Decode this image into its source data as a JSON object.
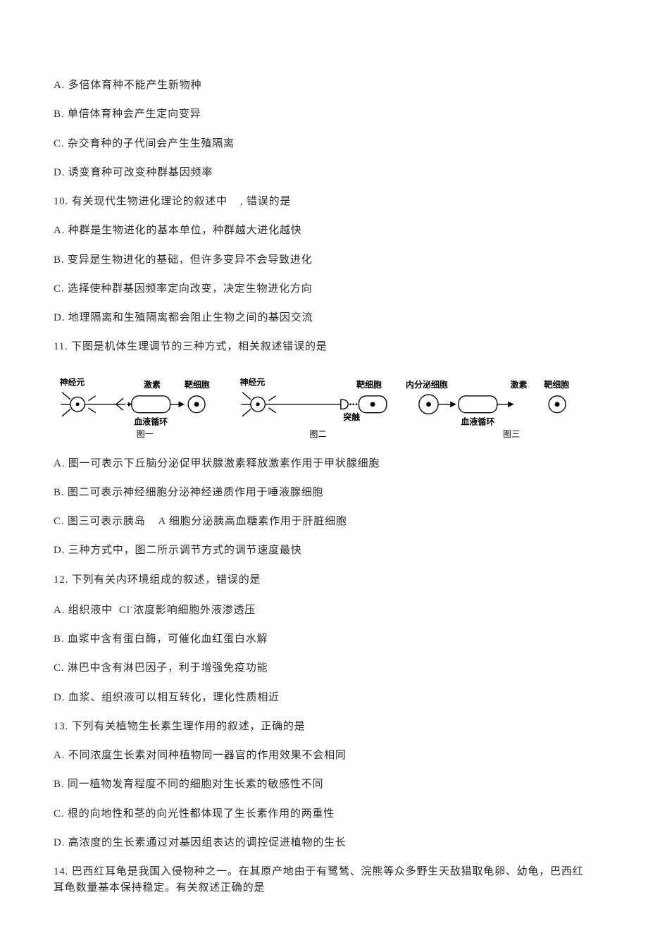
{
  "q9": {
    "A": "A. 多倍体育种不能产生新物种",
    "B": "B. 单倍体育种会产生定向变异",
    "C": "C. 杂交育种的子代间会产生生殖隔离",
    "D": "D. 诱变育种可改变种群基因频率"
  },
  "q10": {
    "stem_a": "10. 有关现代生物进化理论的叙述中",
    "stem_b": ", 错误的是",
    "A": "A. 种群是生物进化的基本单位，种群越大进化越快",
    "B": "B. 变异是生物进化的基础，但许多变异不会导致进化",
    "C": "C. 选择使种群基因频率定向改变，决定生物进化方向",
    "D": "D. 地理隔离和生殖隔离都会阻止生物之间的基因交流"
  },
  "q11": {
    "stem": "11. 下图是机体生理调节的三种方式，相关叙述错误的是",
    "fig_labels": {
      "neuron": "神经元",
      "hormone": "激素",
      "target": "靶细胞",
      "blood": "血液循环",
      "synapse": "突触",
      "endocrine": "内分泌细胞",
      "fig1": "图一",
      "fig2": "图二",
      "fig3": "图三"
    },
    "A": "A. 图一可表示下丘脑分泌促甲状腺激素释放激素作用于甲状腺细胞",
    "B": "B. 图二可表示神经细胞分泌神经递质作用于唾液腺细胞",
    "C_a": "C. 图三可表示胰岛",
    "C_b": "A 细胞分泌胰高血糖素作用于肝脏细胞",
    "D": "D. 三种方式中，图二所示调节方式的调节速度最快"
  },
  "q12": {
    "stem": "12. 下列有关内环境组成的叙述，错误的是",
    "A_a": "A. 组织液中",
    "A_b": "Cl",
    "A_sup": "-",
    "A_c": "浓度影响细胞外液渗透压",
    "B": "B. 血浆中含有蛋白酶，可催化血红蛋白水解",
    "C": "C. 淋巴中含有淋巴因子，利于增强免疫功能",
    "D": "D. 血浆、组织液可以相互转化，理化性质相近"
  },
  "q13": {
    "stem": "13. 下列有关植物生长素生理作用的叙述，正确的是",
    "A": "A. 不同浓度生长素对同种植物同一器官的作用效果不会相同",
    "B": "B. 同一植物发育程度不同的细胞对生长素的敏感性不同",
    "C": "C. 根的向地性和茎的向光性都体现了生长素作用的两重性",
    "D": "D. 高浓度的生长素通过对基因组表达的调控促进植物的生长"
  },
  "q14": {
    "stem": "14. 巴西红耳龟是我国入侵物种之一。在其原产地由于有鹭鸶、浣熊等众多野生天敌猎取龟卵、幼龟，巴西红耳龟数量基本保持稳定。有关叙述正确的是"
  }
}
